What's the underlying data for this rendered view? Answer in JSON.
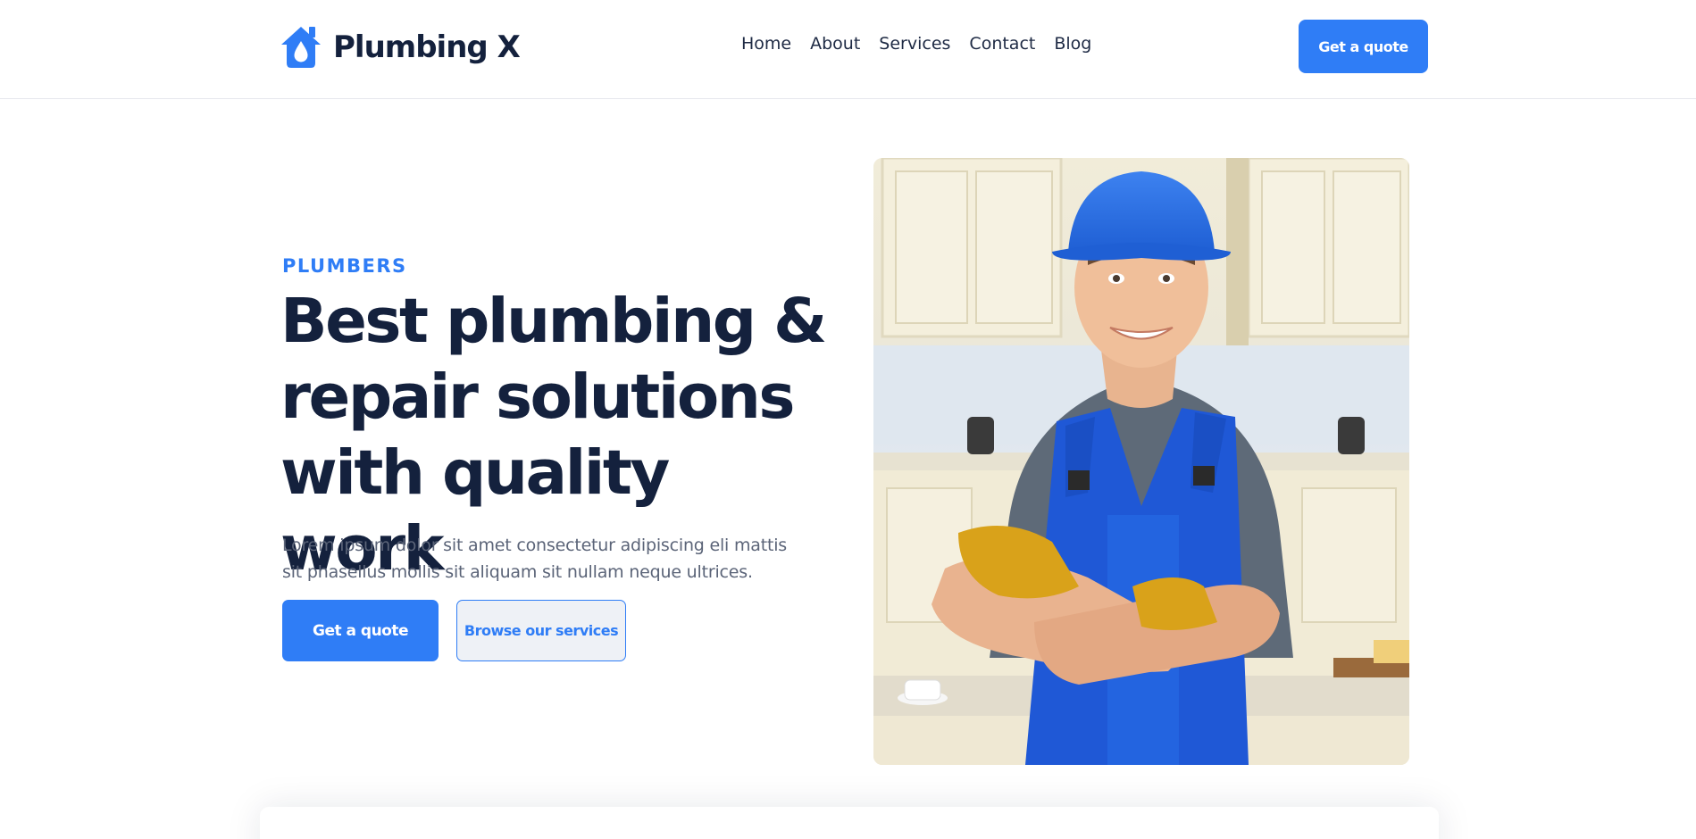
{
  "header": {
    "logo_text": "Plumbing X",
    "nav": [
      "Home",
      "About",
      "Services",
      "Contact",
      "Blog"
    ],
    "cta_label": "Get a quote"
  },
  "hero": {
    "eyebrow": "PLUMBERS",
    "title": "Best plumbing & repair solutions with quality work",
    "description": "Lorem ipsum dolor sit amet consectetur adipiscing eli mattis sit phasellus mollis sit aliquam sit nullam neque ultrices.",
    "primary_button": "Get a quote",
    "secondary_button": "Browse our services"
  },
  "colors": {
    "accent": "#2f7df6",
    "heading": "#14213d",
    "body_text": "#5b6478",
    "helmet": "#2f6fe0",
    "gloves": "#d9a21a"
  },
  "icons": {
    "logo": "house-water-drop-icon"
  }
}
